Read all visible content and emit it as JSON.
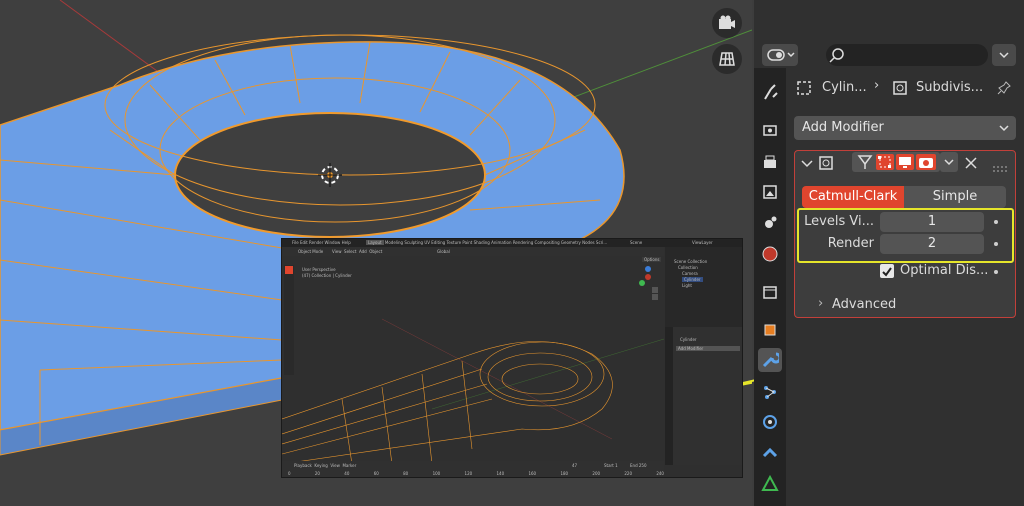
{
  "viewport": {
    "gizmo_buttons": [
      "camera-icon",
      "grid-icon"
    ]
  },
  "properties": {
    "breadcrumb": {
      "object": "Cylin...",
      "modifier": "Subdivis..."
    },
    "add_modifier_label": "Add Modifier",
    "modifier": {
      "mode_options": [
        "Catmull-Clark",
        "Simple"
      ],
      "selected_mode": "Catmull-Clark",
      "levels_viewport_label": "Levels Vi...",
      "levels_viewport_value": "1",
      "render_label": "Render",
      "render_value": "2",
      "optimal_display_label": "Optimal Dis...",
      "optimal_display_checked": true,
      "advanced_label": "Advanced"
    }
  },
  "inset": {
    "menu": [
      "File",
      "Edit",
      "Render",
      "Window",
      "Help"
    ],
    "workspaces": [
      "Layout",
      "Modeling",
      "Sculpting",
      "UV Editing",
      "Texture Paint",
      "Shading",
      "Animation",
      "Rendering",
      "Compositing",
      "Geometry Nodes",
      "Scri..."
    ],
    "scene_label": "Scene",
    "view_layer_label": "ViewLayer",
    "mode_label": "Object Mode",
    "view_menu": [
      "View",
      "Select",
      "Add",
      "Object"
    ],
    "transform_label": "Global",
    "options_label": "Options",
    "overlay_text": [
      "User Perspective",
      "(47) Collection | Cylinder"
    ],
    "outliner": [
      "Scene Collection",
      "Collection",
      "Camera",
      "Cylinder",
      "Light"
    ],
    "props_object": "Cylinder",
    "props_add_modifier": "Add Modifier",
    "timeline_menu": [
      "Playback",
      "Keying",
      "View",
      "Marker"
    ],
    "current_frame": "47",
    "start_label": "Start",
    "start_value": "1",
    "end_label": "End",
    "end_value": "250",
    "ruler": [
      "0",
      "20",
      "40",
      "60",
      "80",
      "100",
      "120",
      "140",
      "160",
      "180",
      "200",
      "220",
      "240"
    ]
  },
  "colors": {
    "mesh_blue": "#6b9ee6",
    "wire_orange": "#e8962e",
    "accent_red": "#e0452e",
    "highlight_yellow": "#e6e62b"
  }
}
